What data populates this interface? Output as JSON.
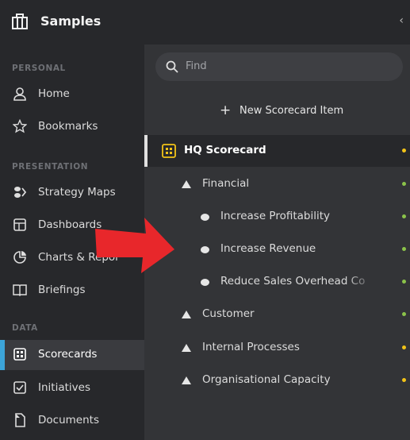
{
  "app": {
    "title": "Samples",
    "collapse_glyph": "‹"
  },
  "sidebar": {
    "sections": [
      {
        "label": "PERSONAL"
      },
      {
        "label": "PRESENTATION"
      },
      {
        "label": "DATA"
      }
    ],
    "items": [
      {
        "label": "Home",
        "icon": "person-icon"
      },
      {
        "label": "Bookmarks",
        "icon": "star-icon"
      },
      {
        "label": "Strategy Maps",
        "icon": "strategy-map-icon"
      },
      {
        "label": "Dashboards",
        "icon": "dashboard-icon"
      },
      {
        "label": "Charts & Repor",
        "icon": "pie-chart-icon"
      },
      {
        "label": "Briefings",
        "icon": "book-icon"
      },
      {
        "label": "Scorecards",
        "icon": "scorecard-icon",
        "active": true
      },
      {
        "label": "Initiatives",
        "icon": "checkbox-icon"
      },
      {
        "label": "Documents",
        "icon": "document-icon"
      }
    ]
  },
  "main": {
    "search_placeholder": "Find",
    "new_item_label": "New Scorecard Item",
    "tree": [
      {
        "label": "HQ Scorecard",
        "status_color": "#f2c318"
      },
      {
        "label": "Financial",
        "status_color": "#8bc34a"
      },
      {
        "label": "Increase Profitability",
        "status_color": "#8bc34a"
      },
      {
        "label": "Increase Revenue",
        "status_color": "#8bc34a"
      },
      {
        "label": "Reduce Sales Overhead Co",
        "status_color": "#8bc34a"
      },
      {
        "label": "Customer",
        "status_color": "#8bc34a"
      },
      {
        "label": "Internal Processes",
        "status_color": "#f2c318"
      },
      {
        "label": "Organisational Capacity",
        "status_color": "#f2c318"
      }
    ]
  },
  "colors": {
    "accent": "#3ca4d8",
    "arrow": "#e8272b",
    "scorecard_icon": "#f2c318"
  }
}
